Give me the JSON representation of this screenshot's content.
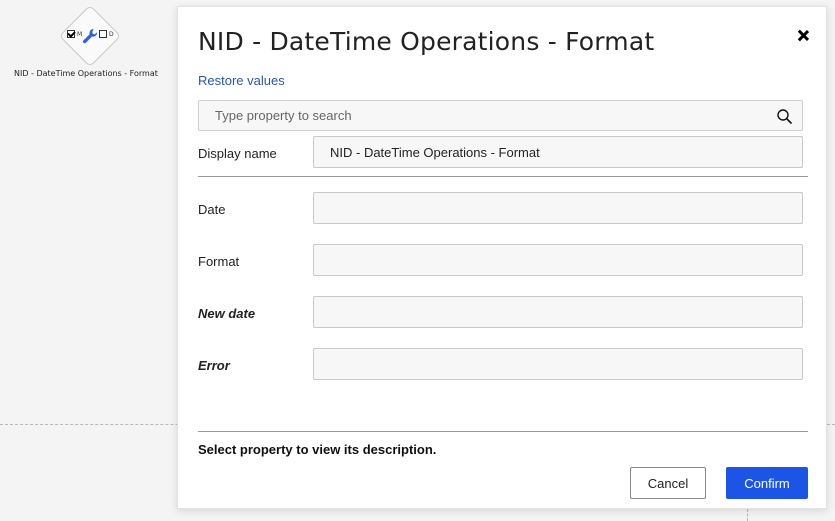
{
  "canvas": {
    "node": {
      "title": "NID - DateTime Operations - Format",
      "checkbox_m_label": "M",
      "checkbox_m_checked": true,
      "checkbox_d_label": "D",
      "checkbox_d_checked": false,
      "icon": "wrench-icon",
      "icon_color": "#2c5ee8"
    }
  },
  "dialog": {
    "title": "NID - DateTime Operations - Format",
    "close_icon": "close-icon",
    "restore_label": "Restore values",
    "search": {
      "placeholder": "Type property to search",
      "value": "",
      "icon": "search-icon"
    },
    "display_name": {
      "label": "Display name",
      "value": "NID - DateTime Operations - Format"
    },
    "properties": [
      {
        "label": "Date",
        "value": "",
        "italic": false
      },
      {
        "label": "Format",
        "value": "",
        "italic": false
      },
      {
        "label": "New date",
        "value": "",
        "italic": true
      },
      {
        "label": "Error",
        "value": "",
        "italic": true
      }
    ],
    "description": "Select property to view its description.",
    "cancel_label": "Cancel",
    "confirm_label": "Confirm",
    "confirm_color": "#1c54e6"
  }
}
